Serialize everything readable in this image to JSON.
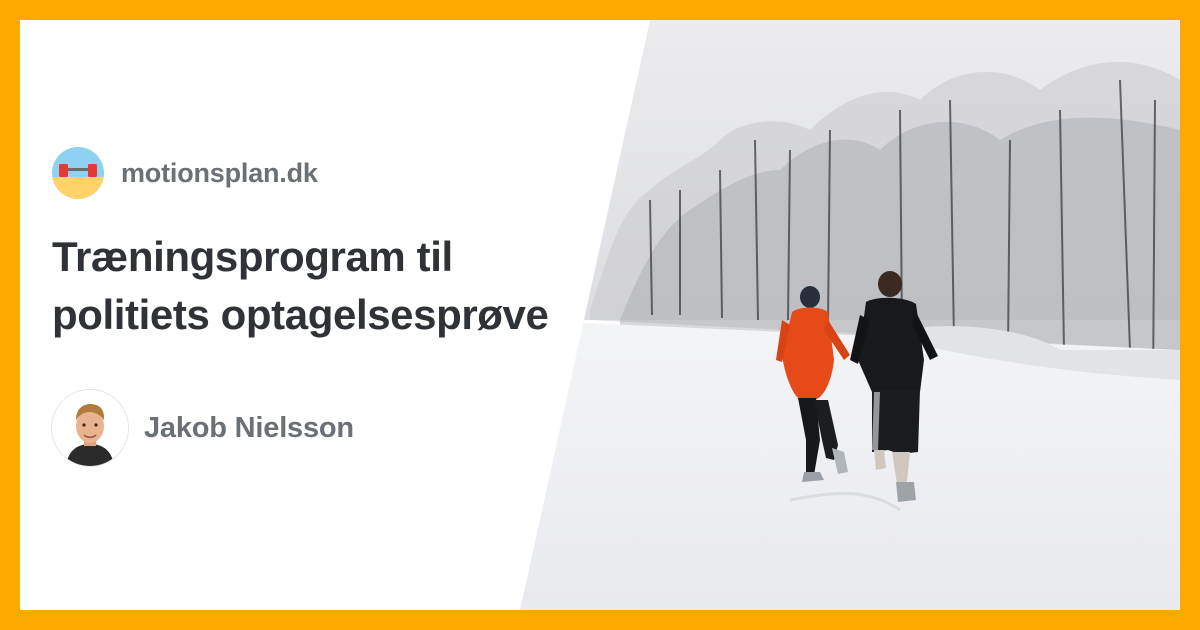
{
  "site": {
    "name": "motionsplan.dk",
    "logo_icon": "beach-dumbbell-logo-icon"
  },
  "article": {
    "title_line1": "Træningsprogram til",
    "title_line2": "politiets optagelsesprøve"
  },
  "author": {
    "name": "Jakob Nielsson",
    "avatar_icon": "author-avatar-icon"
  },
  "photo": {
    "subject": "winter-running-photo",
    "colors": {
      "frame": "#FFA800",
      "jacket_red": "#E64A19",
      "snow": "#F4F5F7",
      "sky": "#E6E7EA"
    }
  }
}
